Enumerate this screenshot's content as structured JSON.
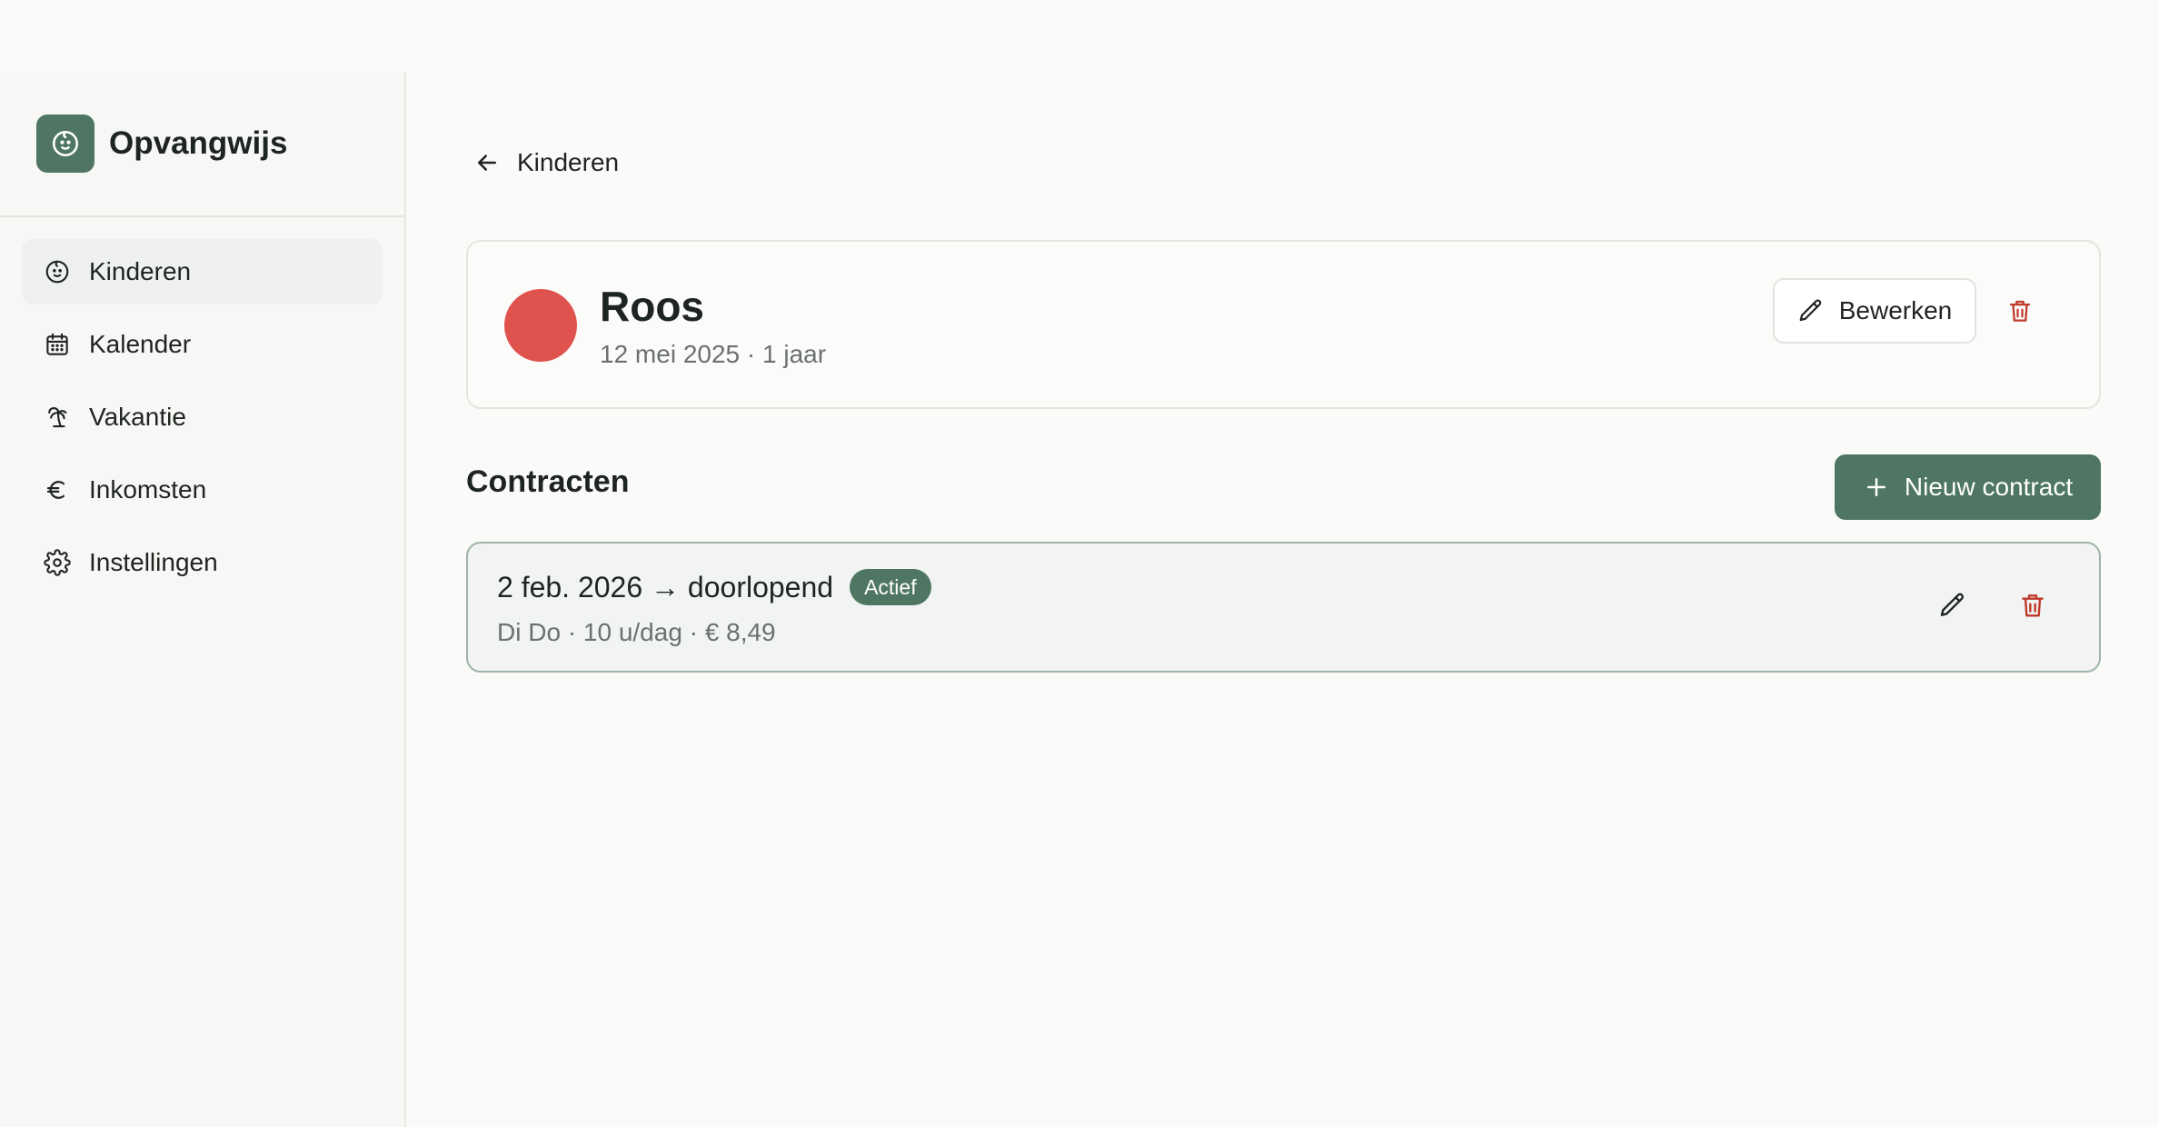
{
  "brand": {
    "name": "Opvangwijs",
    "logo_icon": "baby-face-icon",
    "color": "#4f7663"
  },
  "sidebar": {
    "items": [
      {
        "label": "Kinderen",
        "icon": "baby-face-icon",
        "active": true
      },
      {
        "label": "Kalender",
        "icon": "calendar-icon",
        "active": false
      },
      {
        "label": "Vakantie",
        "icon": "palm-tree-icon",
        "active": false
      },
      {
        "label": "Inkomsten",
        "icon": "euro-icon",
        "active": false
      },
      {
        "label": "Instellingen",
        "icon": "gear-icon",
        "active": false
      }
    ]
  },
  "back": {
    "label": "Kinderen",
    "icon": "arrow-left-icon"
  },
  "child": {
    "name": "Roos",
    "meta": "12 mei 2025 · 1 jaar",
    "color": "#e0524d",
    "edit_label": "Bewerken"
  },
  "contracts": {
    "title": "Contracten",
    "new_label": "Nieuw contract",
    "items": [
      {
        "title": "2 feb. 2026 → doorlopend",
        "status": "Actief",
        "meta": "Di Do · 10 u/dag · € 8,49"
      }
    ]
  },
  "colors": {
    "accent": "#4f7663",
    "danger": "#c0392b"
  }
}
